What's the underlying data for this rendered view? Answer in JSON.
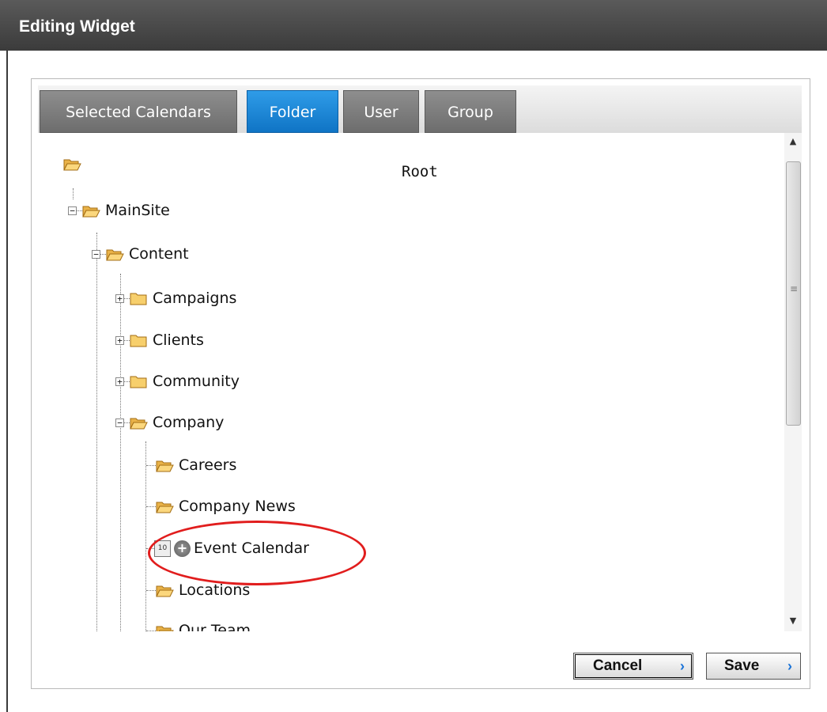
{
  "window": {
    "title": "Editing Widget"
  },
  "tabs": [
    {
      "label": "Selected Calendars",
      "active": false
    },
    {
      "label": "Folder",
      "active": true
    },
    {
      "label": "User",
      "active": false
    },
    {
      "label": "Group",
      "active": false
    }
  ],
  "tree": {
    "root": "Root",
    "mainsite": "MainSite",
    "content": "Content",
    "campaigns": "Campaigns",
    "clients": "Clients",
    "community": "Community",
    "company": "Company",
    "careers": "Careers",
    "company_news": "Company News",
    "event_calendar": "Event Calendar",
    "locations": "Locations",
    "our_team": "Our Team",
    "calendar_icon_text": "10"
  },
  "buttons": {
    "cancel": "Cancel",
    "save": "Save",
    "arrow_glyph": "›"
  },
  "colors": {
    "tab_active": "#1a86d6",
    "highlight": "#e11d1d",
    "button_arrow": "#1a73d8"
  }
}
